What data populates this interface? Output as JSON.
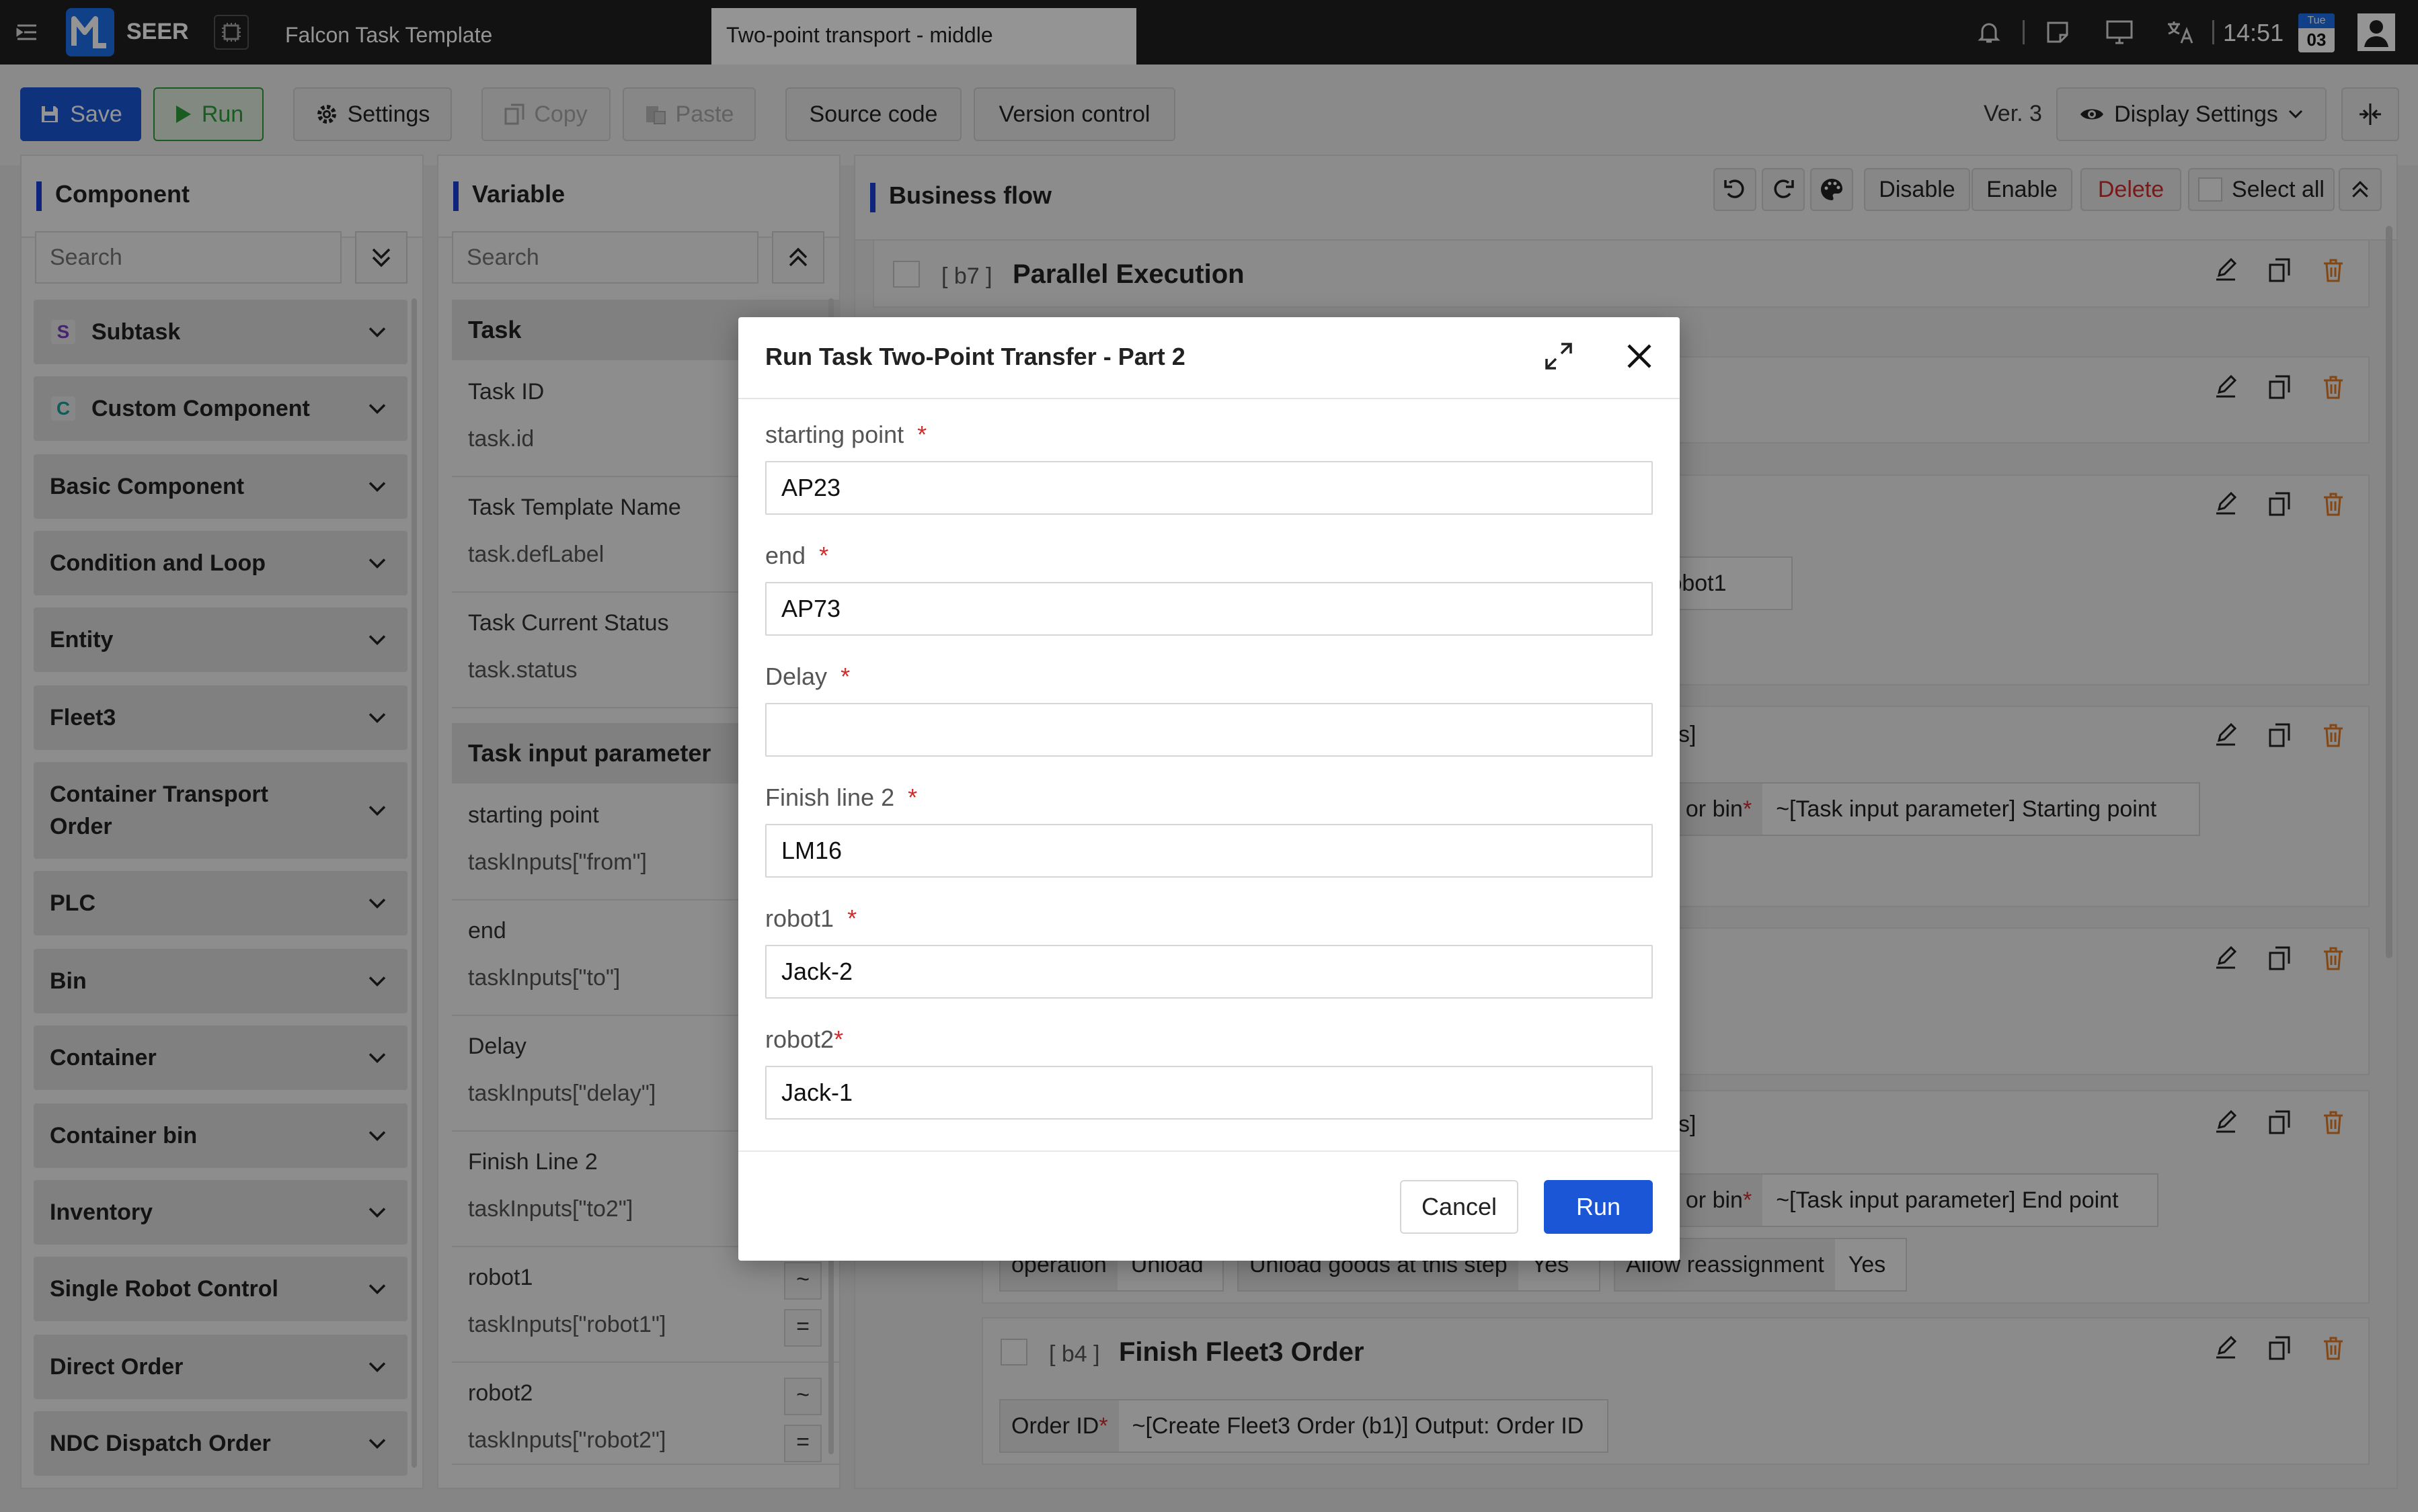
{
  "topbar": {
    "brand": "SEER",
    "app_title": "Falcon Task Template",
    "active_tab": "Two-point transport - middle",
    "time": "14:51",
    "calendar_day": "Tue",
    "calendar_date": "03"
  },
  "toolbar": {
    "save": "Save",
    "run": "Run",
    "settings": "Settings",
    "copy": "Copy",
    "paste": "Paste",
    "source_code": "Source code",
    "version_control": "Version control",
    "version": "Ver. 3",
    "display_settings": "Display Settings"
  },
  "component_panel": {
    "title": "Component",
    "search_placeholder": "Search",
    "items": [
      {
        "badge": "S",
        "label": "Subtask"
      },
      {
        "badge": "C",
        "label": "Custom Component"
      },
      {
        "label": "Basic Component"
      },
      {
        "label": "Condition and Loop"
      },
      {
        "label": "Entity"
      },
      {
        "label": "Fleet3"
      },
      {
        "label": "Container Transport Order"
      },
      {
        "label": "PLC"
      },
      {
        "label": "Bin"
      },
      {
        "label": "Container"
      },
      {
        "label": "Container bin"
      },
      {
        "label": "Inventory"
      },
      {
        "label": "Single Robot Control"
      },
      {
        "label": "Direct Order"
      },
      {
        "label": "NDC Dispatch Order"
      }
    ]
  },
  "variable_panel": {
    "title": "Variable",
    "search_placeholder": "Search",
    "task_header": "Task",
    "task_rows": [
      {
        "name": "Task ID",
        "expr": "task.id"
      },
      {
        "name": "Task Template Name",
        "expr": "task.defLabel"
      },
      {
        "name": "Task Current Status",
        "expr": "task.status"
      }
    ],
    "input_header": "Task input parameter",
    "input_rows": [
      {
        "name": "starting point",
        "expr": "taskInputs[\"from\"]"
      },
      {
        "name": "end",
        "expr": "taskInputs[\"to\"]"
      },
      {
        "name": "Delay",
        "expr": "taskInputs[\"delay\"]"
      },
      {
        "name": "Finish Line 2",
        "expr": "taskInputs[\"to2\"]"
      },
      {
        "name": "robot1",
        "expr": "taskInputs[\"robot1\"]"
      },
      {
        "name": "robot2",
        "expr": "taskInputs[\"robot2\"]"
      }
    ],
    "copy_symbol": "~",
    "eq_symbol": "="
  },
  "flow_panel": {
    "title": "Business flow",
    "disable": "Disable",
    "enable": "Enable",
    "delete": "Delete",
    "select_all": "Select all",
    "b7_id": "[ b7 ]",
    "b7_title": "Parallel Execution",
    "frag_robot1": "er] robot1",
    "frag_s1": "s]",
    "frag_bin": "t or bin",
    "start_value": "~[Task input parameter] Starting point",
    "frag_s2": "s]",
    "end_value": "~[Task input parameter] End point",
    "operation_key": "operation",
    "operation_val": "Unload",
    "unload_key": "Unload goods at this step",
    "unload_val": "Yes",
    "realloc_key": "Allow reassignment",
    "realloc_val": "Yes",
    "b4_id": "[ b4 ]",
    "b4_title": "Finish Fleet3 Order",
    "order_key": "Order ID",
    "order_val": "~[Create Fleet3 Order (b1)] Output: Order ID"
  },
  "modal": {
    "title": "Run Task Two-Point Transfer - Part 2",
    "fields": [
      {
        "label": "starting point",
        "value": "AP23"
      },
      {
        "label": "end",
        "value": "AP73"
      },
      {
        "label": "Delay",
        "value": ""
      },
      {
        "label": "Finish line 2",
        "value": "LM16"
      },
      {
        "label": "robot1",
        "value": "Jack-2"
      },
      {
        "label": "robot2",
        "value": "Jack-1"
      }
    ],
    "required_mark": "*",
    "cancel": "Cancel",
    "run": "Run"
  },
  "colors": {
    "accent_blue": "#1a3fd6",
    "run_green": "#2e9e3b",
    "delete_red": "#d12c2c",
    "trash_orange": "#e07a24"
  }
}
